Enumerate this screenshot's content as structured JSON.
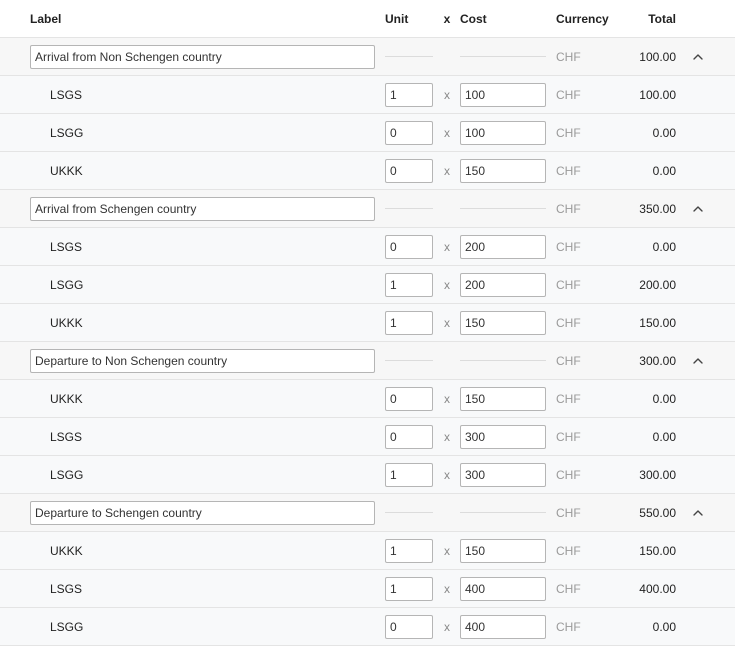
{
  "header": {
    "label": "Label",
    "unit": "Unit",
    "x": "x",
    "cost": "Cost",
    "currency": "Currency",
    "total": "Total"
  },
  "multiply_symbol": "x",
  "groups": [
    {
      "label": "Arrival from Non Schengen country",
      "currency": "CHF",
      "total": "100.00",
      "items": [
        {
          "label": "LSGS",
          "unit": "1",
          "cost": "100",
          "currency": "CHF",
          "total": "100.00"
        },
        {
          "label": "LSGG",
          "unit": "0",
          "cost": "100",
          "currency": "CHF",
          "total": "0.00"
        },
        {
          "label": "UKKK",
          "unit": "0",
          "cost": "150",
          "currency": "CHF",
          "total": "0.00"
        }
      ]
    },
    {
      "label": "Arrival from Schengen country",
      "currency": "CHF",
      "total": "350.00",
      "items": [
        {
          "label": "LSGS",
          "unit": "0",
          "cost": "200",
          "currency": "CHF",
          "total": "0.00"
        },
        {
          "label": "LSGG",
          "unit": "1",
          "cost": "200",
          "currency": "CHF",
          "total": "200.00"
        },
        {
          "label": "UKKK",
          "unit": "1",
          "cost": "150",
          "currency": "CHF",
          "total": "150.00"
        }
      ]
    },
    {
      "label": "Departure to Non Schengen country",
      "currency": "CHF",
      "total": "300.00",
      "items": [
        {
          "label": "UKKK",
          "unit": "0",
          "cost": "150",
          "currency": "CHF",
          "total": "0.00"
        },
        {
          "label": "LSGS",
          "unit": "0",
          "cost": "300",
          "currency": "CHF",
          "total": "0.00"
        },
        {
          "label": "LSGG",
          "unit": "1",
          "cost": "300",
          "currency": "CHF",
          "total": "300.00"
        }
      ]
    },
    {
      "label": "Departure to Schengen country",
      "currency": "CHF",
      "total": "550.00",
      "items": [
        {
          "label": "UKKK",
          "unit": "1",
          "cost": "150",
          "currency": "CHF",
          "total": "150.00"
        },
        {
          "label": "LSGS",
          "unit": "1",
          "cost": "400",
          "currency": "CHF",
          "total": "400.00"
        },
        {
          "label": "LSGG",
          "unit": "0",
          "cost": "400",
          "currency": "CHF",
          "total": "0.00"
        }
      ]
    }
  ],
  "icons": {
    "collapse": "chevron-up-icon"
  },
  "colors": {
    "row_border": "#e4e4e4",
    "muted_text": "#9a9a9a",
    "input_border": "#b5b5b5"
  }
}
